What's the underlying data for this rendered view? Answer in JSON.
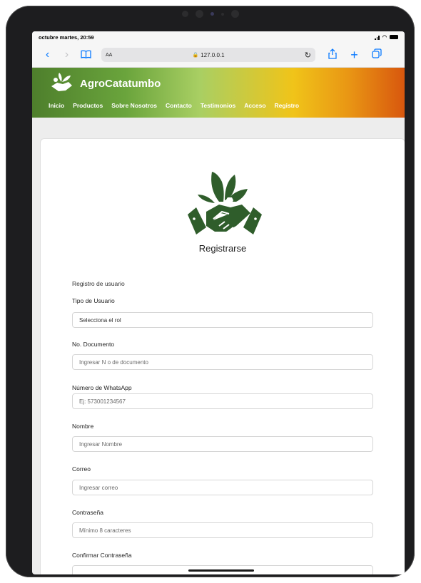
{
  "status_bar": {
    "time": "octubre martes, 20:59"
  },
  "browser": {
    "reader_label": "AA",
    "url": "127.0.0.1"
  },
  "site": {
    "brand": "AgroCatatumbo",
    "nav": [
      "Inicio",
      "Productos",
      "Sobre Nosotros",
      "Contacto",
      "Testimonios",
      "Acceso",
      "Registro"
    ]
  },
  "form": {
    "title": "Registrarse",
    "section": "Registro de usuario",
    "fields": [
      {
        "label": "Tipo de Usuario",
        "value": "Selecciona el rol"
      },
      {
        "label": "No. Documento",
        "placeholder": "Ingresar N o de documento"
      },
      {
        "label": "Número de WhatsApp",
        "placeholder": "Ej: 573001234567"
      },
      {
        "label": "Nombre",
        "placeholder": "Ingresar Nombre"
      },
      {
        "label": "Correo",
        "placeholder": "Ingresar correo"
      },
      {
        "label": "Contraseña",
        "placeholder": "Mínimo 8 caracteres"
      },
      {
        "label": "Confirmar Contraseña",
        "placeholder": ""
      }
    ]
  },
  "colors": {
    "brand_green": "#2f5d2b",
    "link_blue": "#0a7aff"
  }
}
